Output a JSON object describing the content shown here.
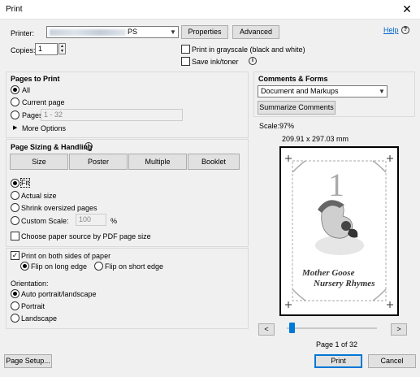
{
  "window": {
    "title": "Print",
    "close_glyph": "✕"
  },
  "printer": {
    "label": "Printer:",
    "selected_suffix": "PS",
    "properties_label": "Properties",
    "advanced_label": "Advanced",
    "help_label": "Help"
  },
  "copies": {
    "label": "Copies:",
    "value": "1"
  },
  "options": {
    "grayscale_label": "Print in grayscale (black and white)",
    "save_ink_label": "Save ink/toner"
  },
  "pages_to_print": {
    "heading": "Pages to Print",
    "all_label": "All",
    "current_label": "Current page",
    "pages_label": "Pages",
    "pages_value": "1 - 32",
    "more_options_label": "More Options"
  },
  "sizing": {
    "heading": "Page Sizing & Handling",
    "tabs": [
      "Size",
      "Poster",
      "Multiple",
      "Booklet"
    ],
    "fit_label": "Fit",
    "actual_label": "Actual size",
    "shrink_label": "Shrink oversized pages",
    "custom_label": "Custom Scale:",
    "custom_value": "100",
    "custom_unit": "%",
    "paper_source_label": "Choose paper source by PDF page size"
  },
  "duplex": {
    "both_sides_label": "Print on both sides of paper",
    "long_edge_label": "Flip on long edge",
    "short_edge_label": "Flip on short edge"
  },
  "orientation": {
    "heading": "Orientation:",
    "auto_label": "Auto portrait/landscape",
    "portrait_label": "Portrait",
    "landscape_label": "Landscape"
  },
  "comments": {
    "heading": "Comments & Forms",
    "selected": "Document and Markups",
    "summarize_label": "Summarize Comments"
  },
  "preview": {
    "scale_label": "Scale:",
    "scale_value": "97%",
    "dimensions": "209.91 x 297.03 mm",
    "page_number_text": "1",
    "book_line1": "Mother Goose",
    "book_line2": "Nursery Rhymes",
    "prev_glyph": "<",
    "next_glyph": ">",
    "page_indicator": "Page 1 of 32",
    "slider_fraction": 0.03
  },
  "footer": {
    "page_setup_label": "Page Setup...",
    "print_label": "Print",
    "cancel_label": "Cancel"
  }
}
